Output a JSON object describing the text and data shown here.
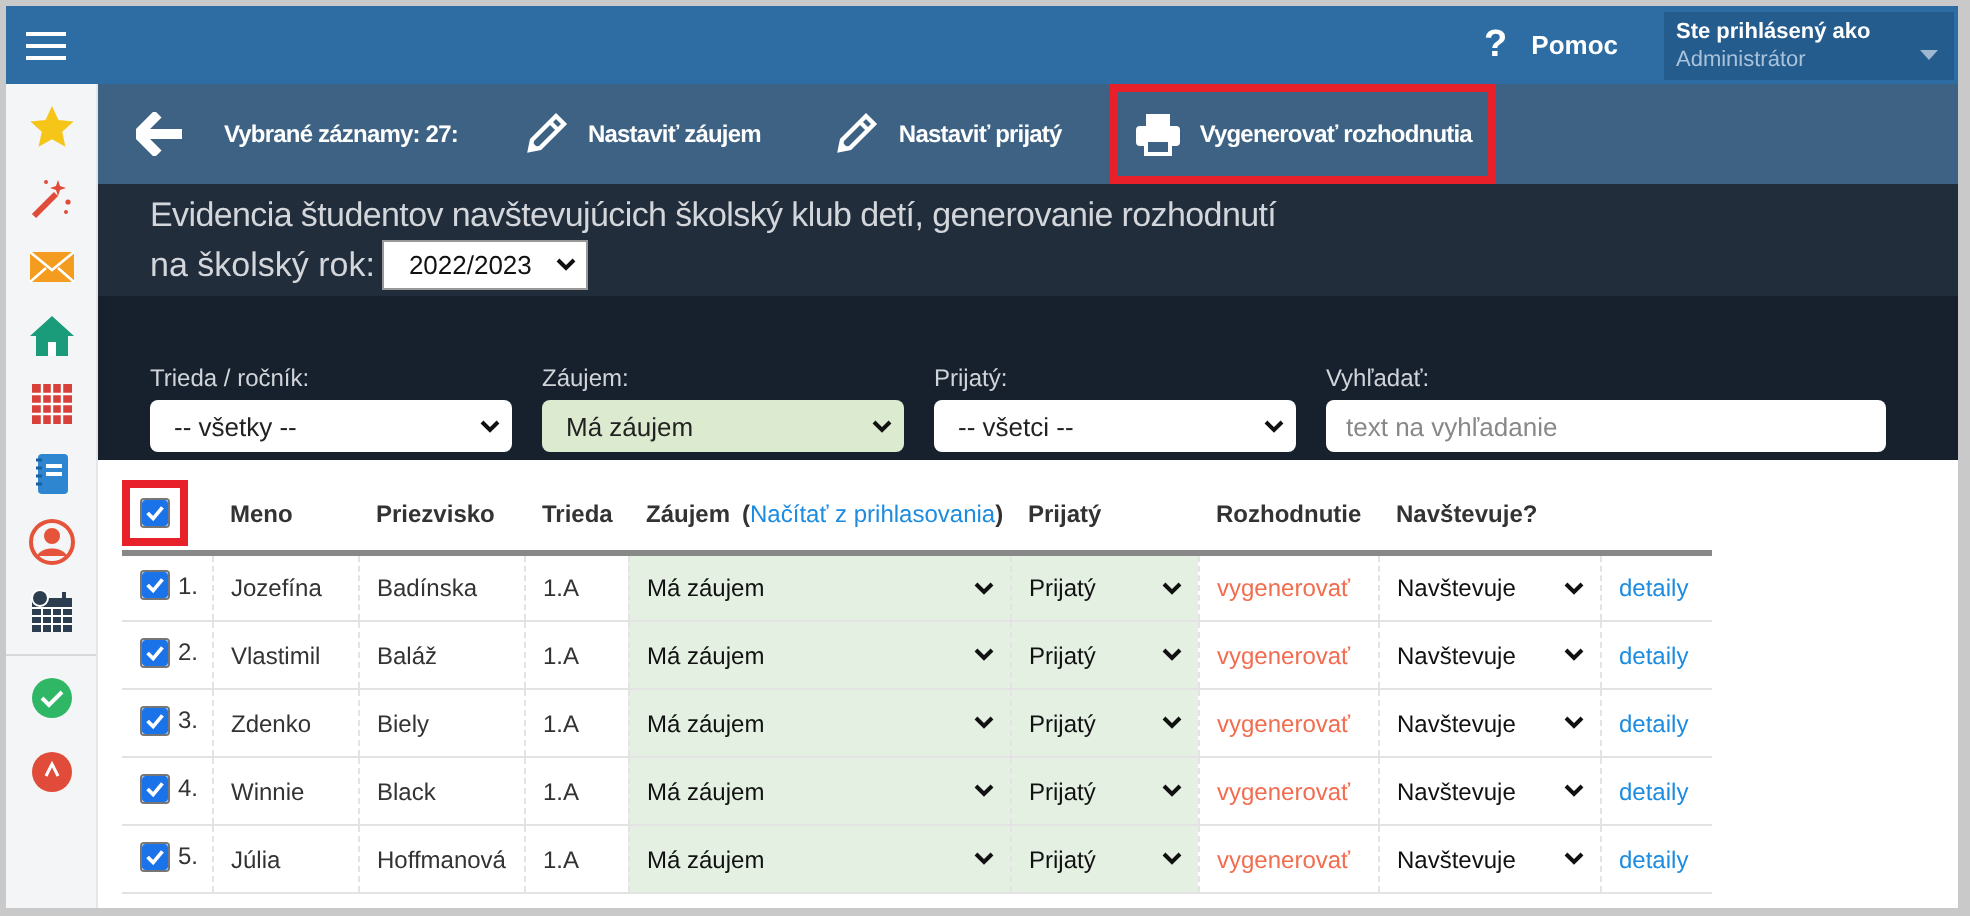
{
  "top_bar": {
    "help_icon": "?",
    "help_label": "Pomoc",
    "user": {
      "caption": "Ste prihlásený ako",
      "name": "Administrátor"
    }
  },
  "sidebar": {
    "items": [
      {
        "kind": "star"
      },
      {
        "kind": "wand"
      },
      {
        "kind": "mail"
      },
      {
        "kind": "home"
      },
      {
        "kind": "calendar"
      },
      {
        "kind": "notebook"
      },
      {
        "kind": "person"
      },
      {
        "kind": "schedule"
      },
      {
        "kind": "divider"
      },
      {
        "kind": "check"
      },
      {
        "kind": "alert"
      }
    ]
  },
  "toolbar": {
    "selected_count": "Vybrané záznamy: 27:",
    "actions": [
      {
        "kind": "edit",
        "label": "Nastaviť záujem",
        "highlighted": false
      },
      {
        "kind": "edit",
        "label": "Nastaviť prijatý",
        "highlighted": false
      },
      {
        "kind": "print",
        "label": "Vygenerovať rozhodnutia",
        "highlighted": true
      }
    ]
  },
  "header": {
    "title": "Evidencia študentov navštevujúcich školský klub detí, generovanie rozhodnutí",
    "year_label": "na školský rok:",
    "year": "2022/2023"
  },
  "filters": [
    {
      "kind": "select",
      "label": "Trieda / ročník:",
      "value": "-- všetky --",
      "tinted": false
    },
    {
      "kind": "select",
      "label": "Záujem:",
      "value": "Má záujem",
      "tinted": true
    },
    {
      "kind": "select",
      "label": "Prijatý:",
      "value": "-- všetci --",
      "tinted": false
    },
    {
      "kind": "search",
      "label": "Vyhľadať:",
      "placeholder": "text na vyhľadanie"
    }
  ],
  "table": {
    "select_all": {
      "checked": true,
      "highlighted": true
    },
    "columns": [
      {
        "label": "Meno"
      },
      {
        "label": "Priezvisko"
      },
      {
        "label": "Trieda"
      },
      {
        "label": "Záujem",
        "link_open": "(",
        "link": "Načítať z prihlasovania",
        "link_close": ")"
      },
      {
        "label": "Prijatý"
      },
      {
        "label": "Rozhodnutie"
      },
      {
        "label": "Navštevuje?"
      }
    ],
    "rows": [
      {
        "checked": true,
        "number": "1.",
        "first_name": "Jozefína",
        "last_name": "Badínska",
        "class": "1.A",
        "interest": "Má záujem",
        "accepted": "Prijatý",
        "decision": "vygenerovať",
        "attends": "Navštevuje",
        "details": "detaily"
      },
      {
        "checked": true,
        "number": "2.",
        "first_name": "Vlastimil",
        "last_name": "Baláž",
        "class": "1.A",
        "interest": "Má záujem",
        "accepted": "Prijatý",
        "decision": "vygenerovať",
        "attends": "Navštevuje",
        "details": "detaily"
      },
      {
        "checked": true,
        "number": "3.",
        "first_name": "Zdenko",
        "last_name": "Biely",
        "class": "1.A",
        "interest": "Má záujem",
        "accepted": "Prijatý",
        "decision": "vygenerovať",
        "attends": "Navštevuje",
        "details": "detaily"
      },
      {
        "checked": true,
        "number": "4.",
        "first_name": "Winnie",
        "last_name": "Black",
        "class": "1.A",
        "interest": "Má záujem",
        "accepted": "Prijatý",
        "decision": "vygenerovať",
        "attends": "Navštevuje",
        "details": "detaily"
      },
      {
        "checked": true,
        "number": "5.",
        "first_name": "Júlia",
        "last_name": "Hoffmanová",
        "class": "1.A",
        "interest": "Má záujem",
        "accepted": "Prijatý",
        "decision": "vygenerovať",
        "attends": "Navštevuje",
        "details": "detaily"
      }
    ]
  }
}
